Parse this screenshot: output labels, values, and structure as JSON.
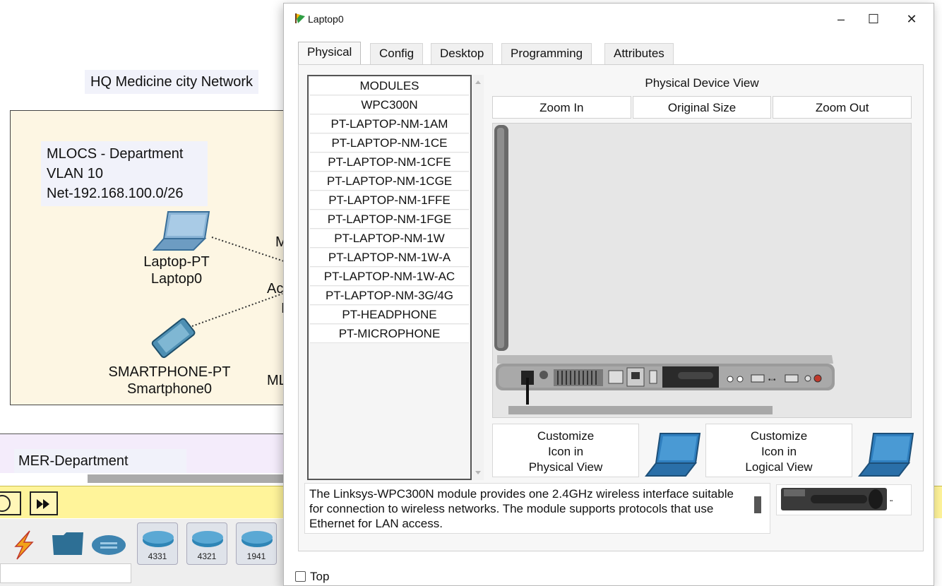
{
  "workspace": {
    "network_title": "HQ Medicine city Network",
    "department": {
      "line1": "MLOCS - Department",
      "line2": "VLAN 10",
      "line3": "Net-192.168.100.0/26"
    },
    "laptop": {
      "type": "Laptop-PT",
      "name": "Laptop0"
    },
    "smartphone": {
      "type": "SMARTPHONE-PT",
      "name": "Smartphone0"
    },
    "clipped_fragments": [
      "M",
      "Ac",
      "I",
      "ML"
    ],
    "mer_department": "MER-Department",
    "router_tiles": [
      "4331",
      "4321",
      "1941"
    ]
  },
  "dialog": {
    "title": "Laptop0",
    "window_controls": {
      "minimize": "–",
      "maximize": "☐",
      "close": "✕"
    },
    "tabs": [
      {
        "label": "Physical",
        "active": true
      },
      {
        "label": "Config",
        "active": false
      },
      {
        "label": "Desktop",
        "active": false
      },
      {
        "label": "Programming",
        "active": false
      },
      {
        "label": "Attributes",
        "active": false
      }
    ],
    "modules": {
      "header": "MODULES",
      "items": [
        "WPC300N",
        "PT-LAPTOP-NM-1AM",
        "PT-LAPTOP-NM-1CE",
        "PT-LAPTOP-NM-1CFE",
        "PT-LAPTOP-NM-1CGE",
        "PT-LAPTOP-NM-1FFE",
        "PT-LAPTOP-NM-1FGE",
        "PT-LAPTOP-NM-1W",
        "PT-LAPTOP-NM-1W-A",
        "PT-LAPTOP-NM-1W-AC",
        "PT-LAPTOP-NM-3G/4G",
        "PT-HEADPHONE",
        "PT-MICROPHONE"
      ]
    },
    "physical_view": {
      "title": "Physical Device View",
      "zoom_in": "Zoom In",
      "original_size": "Original Size",
      "zoom_out": "Zoom Out"
    },
    "customize_physical": {
      "line1": "Customize",
      "line2": "Icon in",
      "line3": "Physical View"
    },
    "customize_logical": {
      "line1": "Customize",
      "line2": "Icon in",
      "line3": "Logical View"
    },
    "description": "The Linksys-WPC300N module provides one 2.4GHz wireless interface suitable for connection to wireless networks. The module supports protocols that use Ethernet for LAN access.",
    "top_checkbox": {
      "label": "Top",
      "checked": false
    }
  },
  "colors": {
    "department_fill": "#fdf6e3",
    "mer_fill": "#f4ecfb",
    "sim_bar": "#fff49a",
    "label_bg": "#f1f2fa",
    "laptop_blue": "#2f7fbf"
  }
}
